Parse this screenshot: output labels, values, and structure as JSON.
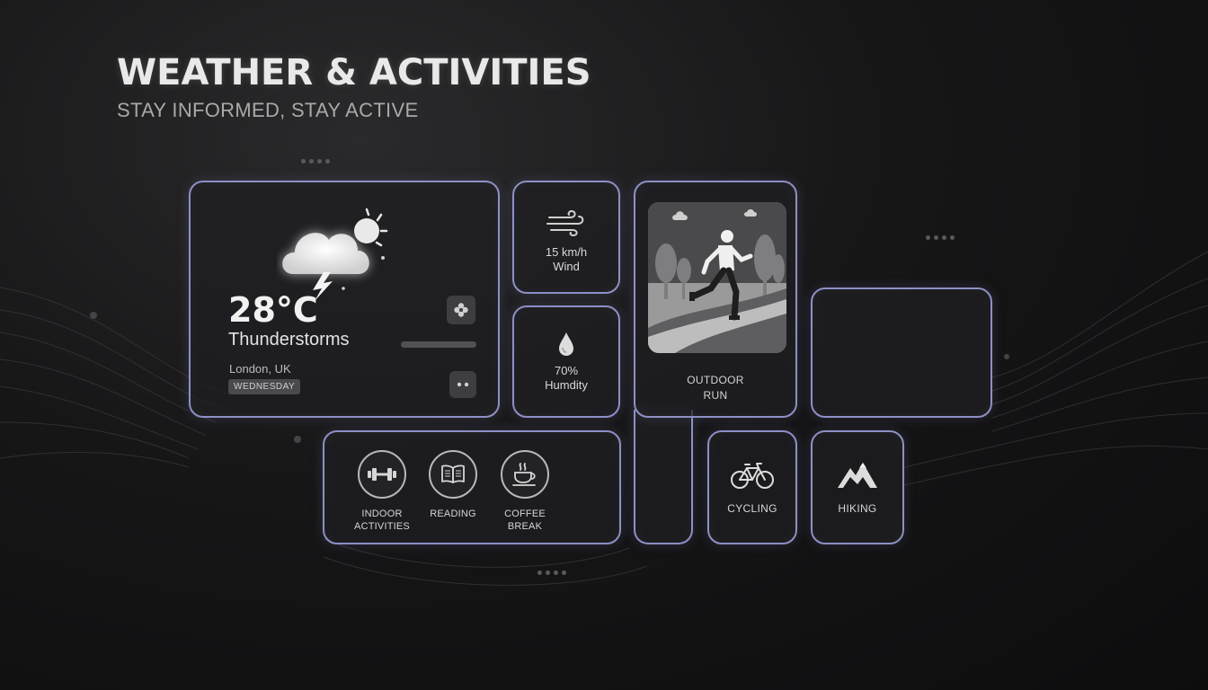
{
  "header": {
    "title": "WEATHER & ACTIVITIES",
    "subtitle": "STAY INFORMED, STAY ACTIVE"
  },
  "weather": {
    "temperature": "28°C",
    "condition": "Thunderstorms",
    "location": "London, UK",
    "day": "WEDNESDAY",
    "icon": "thunderstorm-sun-icon"
  },
  "wind": {
    "value": "15 km/h",
    "label": "Wind",
    "icon": "wind-icon"
  },
  "humidity": {
    "value": "70%",
    "label": "Humdity",
    "icon": "droplet-icon"
  },
  "outdoor_run": {
    "line1": "OUTDOOR",
    "line2": "RUN"
  },
  "activities": [
    {
      "line1": "INDOOR",
      "line2": "ACTIVITIES",
      "icon": "dumbbell-icon"
    },
    {
      "line1": "READING",
      "line2": "",
      "icon": "book-icon"
    },
    {
      "line1": "COFFEE",
      "line2": "BREAK",
      "icon": "coffee-cup-icon"
    }
  ],
  "cycling": {
    "label": "CYCLING",
    "icon": "bicycle-icon"
  },
  "hiking": {
    "label": "HIKING",
    "icon": "mountain-icon"
  },
  "colors": {
    "card_border": "#8d90c4",
    "background": "#161617",
    "text": "#e6e6e6"
  }
}
